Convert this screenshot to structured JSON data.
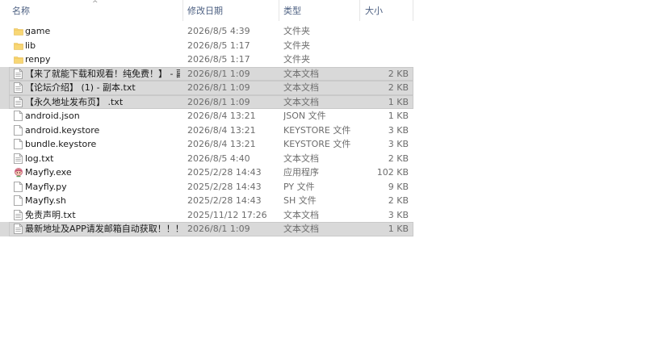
{
  "columns": {
    "name": "名称",
    "date": "修改日期",
    "type": "类型",
    "size": "大小"
  },
  "files": [
    {
      "icon": "folder-icon",
      "name": "game",
      "date": "2026/8/5 4:39",
      "type": "文件夹",
      "size": "",
      "selected": false
    },
    {
      "icon": "folder-icon",
      "name": "lib",
      "date": "2026/8/5 1:17",
      "type": "文件夹",
      "size": "",
      "selected": false
    },
    {
      "icon": "folder-icon",
      "name": "renpy",
      "date": "2026/8/5 1:17",
      "type": "文件夹",
      "size": "",
      "selected": false
    },
    {
      "icon": "text-file-icon",
      "name": "【来了就能下载和观看！纯免费！】 - 副...",
      "date": "2026/8/1 1:09",
      "type": "文本文档",
      "size": "2 KB",
      "selected": true
    },
    {
      "icon": "text-file-icon",
      "name": "【论坛介绍】 (1) - 副本.txt",
      "date": "2026/8/1 1:09",
      "type": "文本文档",
      "size": "2 KB",
      "selected": true
    },
    {
      "icon": "text-file-icon",
      "name": "【永久地址发布页】 .txt",
      "date": "2026/8/1 1:09",
      "type": "文本文档",
      "size": "1 KB",
      "selected": true
    },
    {
      "icon": "blank-file-icon",
      "name": "android.json",
      "date": "2026/8/4 13:21",
      "type": "JSON 文件",
      "size": "1 KB",
      "selected": false
    },
    {
      "icon": "blank-file-icon",
      "name": "android.keystore",
      "date": "2026/8/4 13:21",
      "type": "KEYSTORE 文件",
      "size": "3 KB",
      "selected": false
    },
    {
      "icon": "blank-file-icon",
      "name": "bundle.keystore",
      "date": "2026/8/4 13:21",
      "type": "KEYSTORE 文件",
      "size": "3 KB",
      "selected": false
    },
    {
      "icon": "text-file-icon",
      "name": "log.txt",
      "date": "2026/8/5 4:40",
      "type": "文本文档",
      "size": "2 KB",
      "selected": false
    },
    {
      "icon": "app-exe-icon",
      "name": "Mayfly.exe",
      "date": "2025/2/28 14:43",
      "type": "应用程序",
      "size": "102 KB",
      "selected": false
    },
    {
      "icon": "blank-file-icon",
      "name": "Mayfly.py",
      "date": "2025/2/28 14:43",
      "type": "PY 文件",
      "size": "9 KB",
      "selected": false
    },
    {
      "icon": "blank-file-icon",
      "name": "Mayfly.sh",
      "date": "2025/2/28 14:43",
      "type": "SH 文件",
      "size": "2 KB",
      "selected": false
    },
    {
      "icon": "text-file-icon",
      "name": "免责声明.txt",
      "date": "2025/11/12 17:26",
      "type": "文本文档",
      "size": "3 KB",
      "selected": false
    },
    {
      "icon": "text-file-icon",
      "name": "最新地址及APP请发邮箱自动获取！！！...",
      "date": "2026/8/1 1:09",
      "type": "文本文档",
      "size": "1 KB",
      "selected": true
    }
  ],
  "colors": {
    "header_text": "#4d6082",
    "selection_bg": "#d9d9d9",
    "folder_yellow": "#f8d775"
  }
}
